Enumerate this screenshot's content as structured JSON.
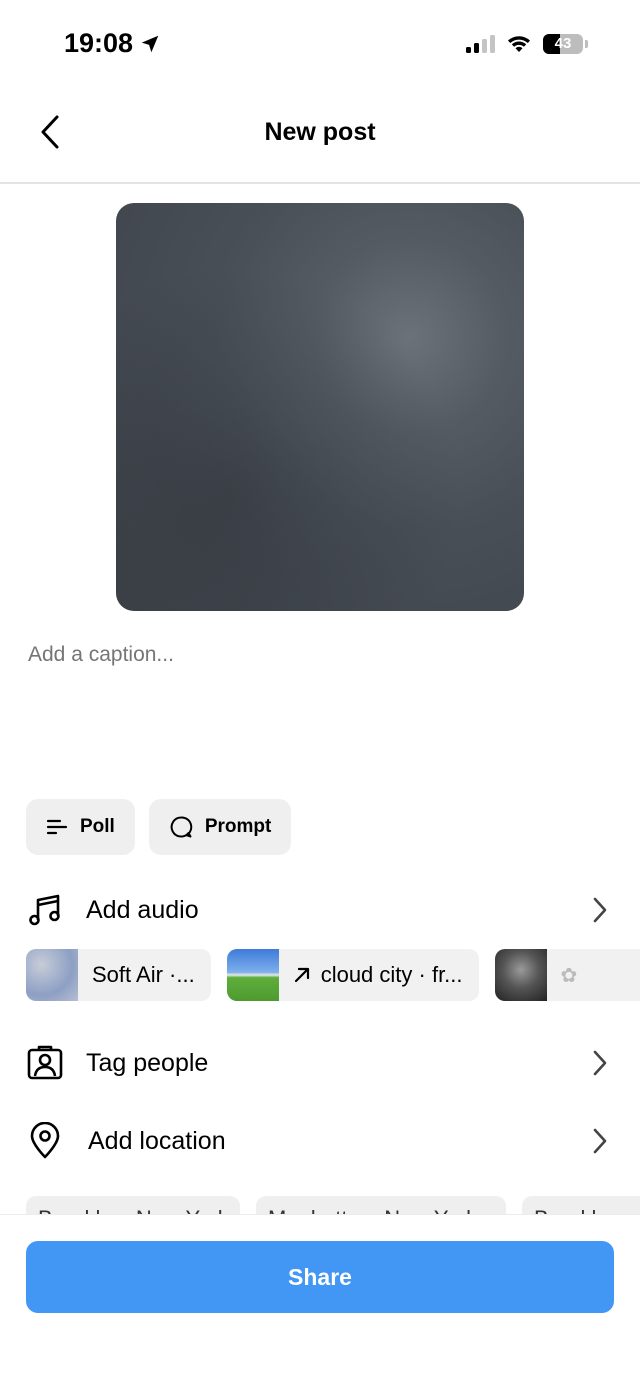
{
  "status_bar": {
    "time": "19:08",
    "battery": "43",
    "battery_level": 0.43
  },
  "nav": {
    "title": "New post"
  },
  "caption": {
    "placeholder": "Add a caption..."
  },
  "chips": [
    {
      "label": "Poll",
      "icon": "poll-icon"
    },
    {
      "label": "Prompt",
      "icon": "chat-bubble-icon"
    }
  ],
  "rows": {
    "audio": {
      "label": "Add audio",
      "icon": "music-note-icon"
    },
    "tag": {
      "label": "Tag people",
      "icon": "tag-person-icon"
    },
    "location": {
      "label": "Add location",
      "icon": "location-pin-icon"
    }
  },
  "audio_suggestions": [
    {
      "title": "Soft Air ·..."
    },
    {
      "title": "cloud city · fr...",
      "trending": true
    },
    {
      "title": ""
    }
  ],
  "location_suggestions": [
    {
      "label": "Brooklyn, New York"
    },
    {
      "label": "Manhattan, New York"
    },
    {
      "label": "Brooklyn"
    }
  ],
  "share": {
    "label": "Share"
  },
  "colors": {
    "accent": "#4296f4",
    "chip_bg": "#efefef",
    "placeholder": "#8e8e8e"
  }
}
